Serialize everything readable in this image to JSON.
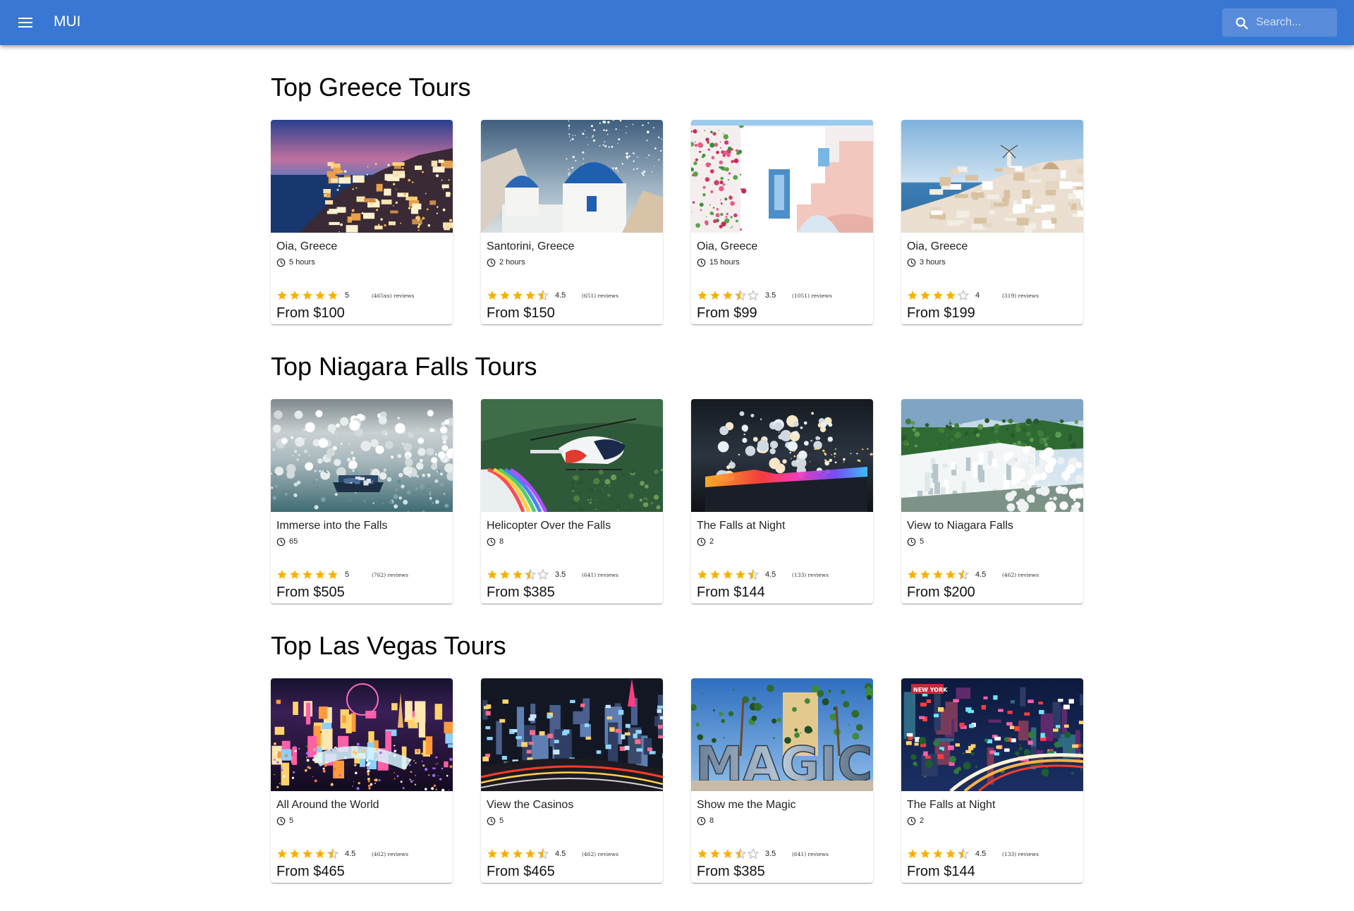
{
  "appbar": {
    "brand": "MUI",
    "background": "#3877d3",
    "search_placeholder": "Search...",
    "menu_icon": "menu-icon",
    "search_icon": "search-icon"
  },
  "labels": {
    "from": "From",
    "reviews_suffix": "reviews"
  },
  "colors": {
    "star": "#faaf00",
    "star_empty": "#bdbdbd"
  },
  "sections": [
    {
      "title": "Top Greece Tours",
      "tours": [
        {
          "name": "Oia, Greece",
          "duration": "5 hours",
          "rating": 5,
          "rating_text": "5",
          "reviews": "(465xx) reviews",
          "price": "From $100",
          "image": "oia-night-town"
        },
        {
          "name": "Santorini, Greece",
          "duration": "2 hours",
          "rating": 4.5,
          "rating_text": "4.5",
          "reviews": "(651) reviews",
          "price": "From $150",
          "image": "santorini-blue-domes"
        },
        {
          "name": "Oia, Greece",
          "duration": "15 hours",
          "rating": 3.5,
          "rating_text": "3.5",
          "reviews": "(1051) reviews",
          "price": "From $99",
          "image": "oia-white-stairs"
        },
        {
          "name": "Oia, Greece",
          "duration": "3 hours",
          "rating": 4,
          "rating_text": "4",
          "reviews": "(319) reviews",
          "price": "From $199",
          "image": "oia-windmills"
        }
      ]
    },
    {
      "title": "Top Niagara Falls Tours",
      "tours": [
        {
          "name": "Immerse into the Falls",
          "duration": "65",
          "rating": 5,
          "rating_text": "5",
          "reviews": "(762) reviews",
          "price": "From $505",
          "image": "boat-in-mist"
        },
        {
          "name": "Helicopter Over the Falls",
          "duration": "8",
          "rating": 3.5,
          "rating_text": "3.5",
          "reviews": "(641) reviews",
          "price": "From $385",
          "image": "helicopter-rainbow"
        },
        {
          "name": "The Falls at Night",
          "duration": "2",
          "rating": 4.5,
          "rating_text": "4.5",
          "reviews": "(133) reviews",
          "price": "From $144",
          "image": "falls-night-lights"
        },
        {
          "name": "View to Niagara Falls",
          "duration": "5",
          "rating": 4.5,
          "rating_text": "4.5",
          "reviews": "(462) reviews",
          "price": "From $200",
          "image": "falls-day-view"
        }
      ]
    },
    {
      "title": "Top Las Vegas Tours",
      "tours": [
        {
          "name": "All Around the World",
          "duration": "5",
          "rating": 4.5,
          "rating_text": "4.5",
          "reviews": "(462) reviews",
          "price": "From $465",
          "image": "vegas-night-aerial"
        },
        {
          "name": "View the Casinos",
          "duration": "5",
          "rating": 4.5,
          "rating_text": "4.5",
          "reviews": "(462) reviews",
          "price": "From $465",
          "image": "vegas-casinos-night"
        },
        {
          "name": "Show me the Magic",
          "duration": "8",
          "rating": 3.5,
          "rating_text": "3.5",
          "reviews": "(641) reviews",
          "price": "From $385",
          "image": "magic-sign"
        },
        {
          "name": "The Falls at Night",
          "duration": "2",
          "rating": 4.5,
          "rating_text": "4.5",
          "reviews": "(133) reviews",
          "price": "From $144",
          "image": "vegas-strip-traffic"
        }
      ]
    }
  ],
  "scene_text": {
    "magic_sign": "MAGIC",
    "vegas_sign": "NEW YORK"
  }
}
